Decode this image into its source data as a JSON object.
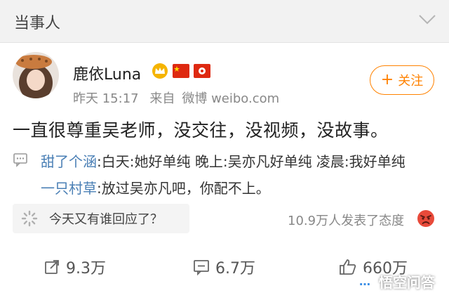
{
  "header": {
    "title": "当事人"
  },
  "post": {
    "author": "鹿依Luna",
    "time": "昨天 15:17",
    "source_prefix": "来自",
    "source": "微博 weibo.com",
    "follow_label": "关注",
    "text": "一直很尊重吴老师，没交往，没视频，没故事。"
  },
  "comments": [
    {
      "user": "甜了个涵",
      "text": ":白天:她好单纯 晚上:吴亦凡好单纯 凌晨:我好单纯"
    },
    {
      "user": "一只村草",
      "text": ":放过吴亦凡吧，你配不上。"
    }
  ],
  "prompt": {
    "text": "今天又有谁回应了？"
  },
  "attitude": {
    "text": "10.9万人发表了态度"
  },
  "actions": {
    "repost": "9.3万",
    "comment": "6.7万",
    "like": "660万"
  },
  "watermark": {
    "text": "悟空问答"
  },
  "colors": {
    "accent": "#ff8200",
    "link": "#4a7fb5",
    "angry": "#e84a3a"
  }
}
